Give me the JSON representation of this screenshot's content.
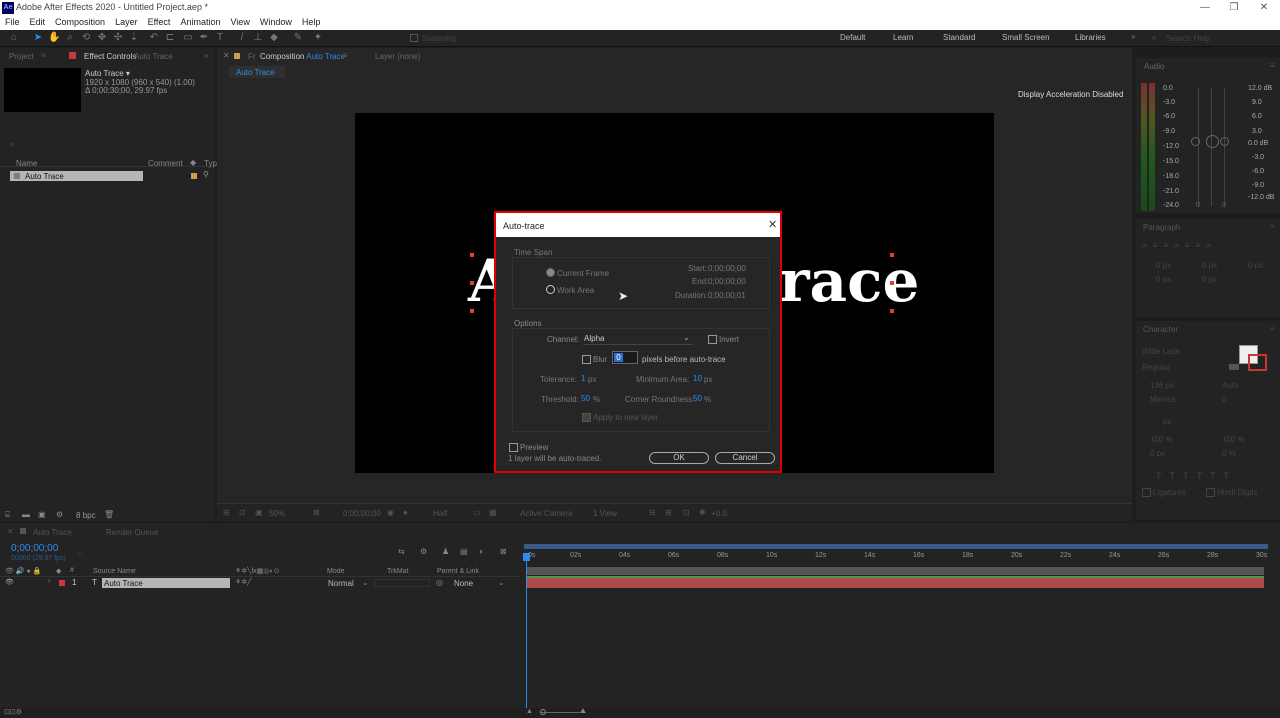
{
  "window": {
    "app_icon": "Ae",
    "title": "Adobe After Effects 2020 - Untitled Project.aep *",
    "minimize": "—",
    "maximize": "❐",
    "close": "✕"
  },
  "menu": [
    "File",
    "Edit",
    "Composition",
    "Layer",
    "Effect",
    "Animation",
    "View",
    "Window",
    "Help"
  ],
  "toolbar": {
    "snapping": "Snapping",
    "workspaces": [
      "Default",
      "Learn",
      "Standard",
      "Small Screen",
      "Libraries"
    ],
    "search_placeholder": "Search Help"
  },
  "project_panel": {
    "tab_project": "Project",
    "tab_effect_controls": "Effect Controls",
    "effect_controls_target": "Auto Trace",
    "item_name": "Auto Trace",
    "item_info_1": "1920 x 1080  (960 x 540) (1.00)",
    "item_info_2": "Δ 0;00;30;00, 29.97 fps",
    "search_placeholder": "",
    "col_name": "Name",
    "col_comment": "Comment",
    "col_type": "Typ",
    "row_name": "Auto Trace",
    "bpc": "8 bpc"
  },
  "comp_panel": {
    "tab_fr": "Fr",
    "tab_prefix": "Composition",
    "tab_name": "Auto Trace",
    "layer_tab": "Layer",
    "layer_none": "(none)",
    "breadcrumb": "Auto Trace",
    "display_accel": "Display Acceleration Disabled",
    "canvas_text_left": "A",
    "canvas_text_right": "race",
    "bottom_zoom": "50%",
    "bottom_time": "0;00;00;00",
    "bottom_quality": "Half",
    "bottom_camera": "Active Camera",
    "bottom_view": "1 View",
    "bottom_exposure": "+0.0"
  },
  "dialog": {
    "title": "Auto-trace",
    "time_span_label": "Time Span",
    "current_frame": "Current Frame",
    "work_area": "Work Area",
    "start_label": "Start:",
    "start_value": "0;00;00;00",
    "end_label": "End:",
    "end_value": "0;00;00;00",
    "duration_label": "Duration:",
    "duration_value": "0;00;00;01",
    "options_label": "Options",
    "channel_label": "Channel:",
    "channel_value": "Alpha",
    "invert": "Invert",
    "blur": "Blur",
    "blur_value": "0",
    "blur_suffix": "pixels before auto-trace",
    "tolerance_label": "Tolerance:",
    "tolerance_value": "1",
    "tolerance_unit": "px",
    "min_area_label": "Minimum Area:",
    "min_area_value": "10",
    "min_area_unit": "px",
    "threshold_label": "Threshold:",
    "threshold_value": "50",
    "threshold_unit": "%",
    "corner_label": "Corner Roundness:",
    "corner_value": "50",
    "corner_unit": "%",
    "apply_new_layer": "Apply to new layer",
    "preview": "Preview",
    "status": "1 layer will be auto-traced.",
    "ok": "OK",
    "cancel": "Cancel"
  },
  "audio_panel": {
    "title": "Audio",
    "left_scale": [
      "0.0",
      "-3.0",
      "-6.0",
      "-9.0",
      "-12.0",
      "-15.0",
      "-18.0",
      "-21.0",
      "-24.0"
    ],
    "right_scale": [
      "12.0 dB",
      "9.0",
      "6.0",
      "3.0",
      "0.0 dB",
      "-3.0",
      "-6.0",
      "-9.0",
      "-12.0 dB"
    ],
    "bottom_left": "0",
    "bottom_right": "0"
  },
  "paragraph_panel": {
    "title": "Paragraph",
    "fields": [
      "0 px",
      "0 px",
      "0 px",
      "0 px",
      "0 px"
    ]
  },
  "character_panel": {
    "title": "Character",
    "font": "Wide Latin",
    "style": "Regular",
    "size": "136 px",
    "leading": "Auto",
    "kerning": "Metrics",
    "tracking": "0",
    "stroke": "- px",
    "vscale": "100 %",
    "hscale": "100 %",
    "baseline": "0 px",
    "tsume": "0 %",
    "ligatures": "Ligatures",
    "hindi_digits": "Hindi Digits"
  },
  "timeline": {
    "tab_name": "Auto Trace",
    "render_queue": "Render Queue",
    "timecode": "0;00;00;00",
    "fps": "00000 (29.97 fps)",
    "col_source": "Source Name",
    "col_mode": "Mode",
    "col_trkmat": "TrkMat",
    "col_parent": "Parent & Link",
    "layer_num": "1",
    "layer_name": "Auto Trace",
    "layer_mode": "Normal",
    "layer_parent": "None",
    "ruler": [
      "0s",
      "02s",
      "04s",
      "06s",
      "08s",
      "10s",
      "12s",
      "14s",
      "16s",
      "18s",
      "20s",
      "22s",
      "24s",
      "26s",
      "28s",
      "30s"
    ]
  },
  "colors": {
    "accent_blue": "#2d8ceb",
    "highlight_red": "#e00000",
    "layer_bar": "#b04a4a",
    "work_area_green": "#4a9a4a"
  }
}
